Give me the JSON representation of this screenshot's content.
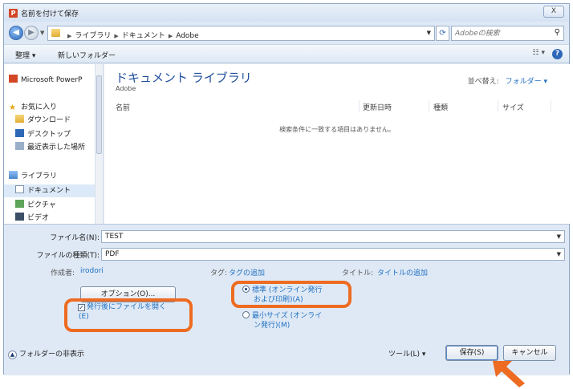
{
  "window": {
    "title": "名前を付けて保存",
    "close_label": "X"
  },
  "address": {
    "crumbs": [
      "ライブラリ",
      "ドキュメント",
      "Adobe"
    ],
    "search_placeholder": "Adobeの検索"
  },
  "toolbar": {
    "organize": "整理 ▾",
    "new_folder": "新しいフォルダー",
    "view": "☷ ▾",
    "help": "?"
  },
  "nav": {
    "items": [
      {
        "label": "Microsoft PowerP",
        "icon": "powerpoint-icon"
      },
      {
        "label": "お気に入り",
        "icon": "star-icon"
      },
      {
        "label": "ダウンロード",
        "icon": "download-folder-icon"
      },
      {
        "label": "デスクトップ",
        "icon": "desktop-icon"
      },
      {
        "label": "最近表示した場所",
        "icon": "recent-places-icon"
      },
      {
        "label": "ライブラリ",
        "icon": "library-icon"
      },
      {
        "label": "ドキュメント",
        "icon": "documents-icon"
      },
      {
        "label": "ピクチャ",
        "icon": "pictures-icon"
      },
      {
        "label": "ビデオ",
        "icon": "videos-icon"
      }
    ]
  },
  "main": {
    "library_title": "ドキュメント ライブラリ",
    "library_sub": "Adobe",
    "sort_label": "並べ替え:",
    "sort_value": "フォルダー ▾",
    "columns": [
      "名前",
      "更新日時",
      "種類",
      "サイズ"
    ],
    "empty_message": "検索条件に一致する項目はありません。"
  },
  "form": {
    "filename_label": "ファイル名(N):",
    "filename_value": "TEST",
    "filetype_label": "ファイルの種類(T):",
    "filetype_value": "PDF",
    "author_label": "作成者:",
    "author_value": "irodori",
    "tags_label": "タグ:",
    "tags_value": "タグの追加",
    "title_label": "タイトル:",
    "title_value": "タイトルの追加",
    "options_button": "オプション(O)...",
    "open_after_line1": "発行後にファイルを開く",
    "open_after_line2": "(E)",
    "radio_standard_line1": "標準 (オンライン発行",
    "radio_standard_line2": "および印刷)(A)",
    "radio_min_line1": "最小サイズ (オンライ",
    "radio_min_line2": "ン発行)(M)",
    "hide_folders": "フォルダーの非表示",
    "tools": "ツール(L)  ▾",
    "save_button": "保存(S)",
    "cancel_button": "キャンセル"
  },
  "colors": {
    "highlight": "#ee6b22",
    "accent": "#1f6fc2"
  }
}
